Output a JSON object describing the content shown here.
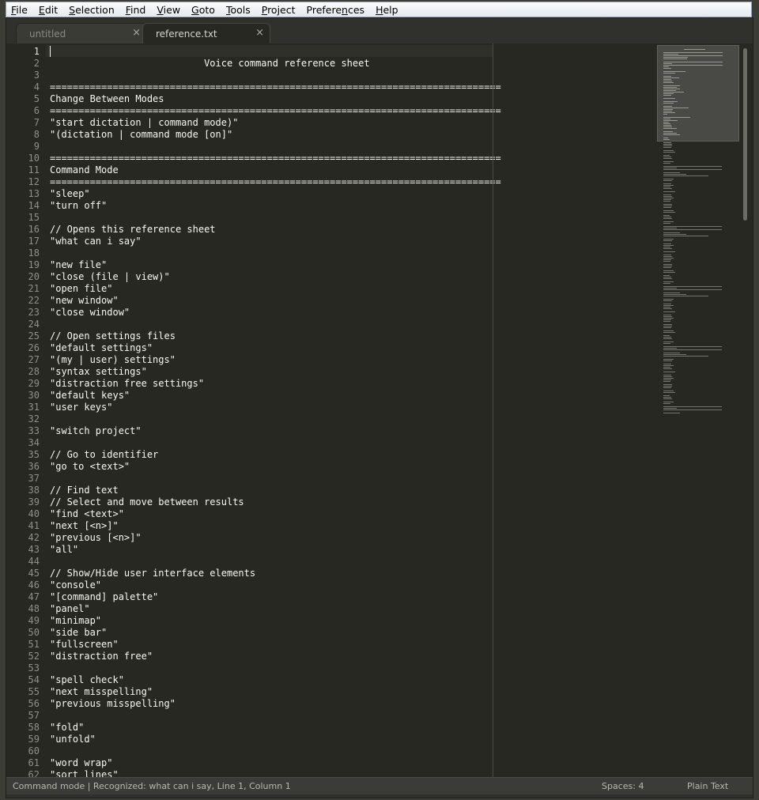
{
  "menu": [
    {
      "label": "File",
      "mnemonic": "F",
      "rest": "ile"
    },
    {
      "label": "Edit",
      "mnemonic": "E",
      "rest": "dit"
    },
    {
      "label": "Selection",
      "mnemonic": "S",
      "rest": "election"
    },
    {
      "label": "Find",
      "mnemonic": "F",
      "rest": "ind",
      "prefix": ""
    },
    {
      "label": "View",
      "mnemonic": "V",
      "rest": "iew"
    },
    {
      "label": "Goto",
      "mnemonic": "G",
      "rest": "oto"
    },
    {
      "label": "Tools",
      "mnemonic": "T",
      "rest": "ools"
    },
    {
      "label": "Project",
      "mnemonic": "P",
      "rest": "roject"
    },
    {
      "label": "Preferences",
      "mnemonic": "n",
      "prefix": "Prefere",
      "rest": "ces"
    },
    {
      "label": "Help",
      "mnemonic": "H",
      "rest": "elp"
    }
  ],
  "tabs": [
    {
      "title": "untitled",
      "close": "×",
      "active": false
    },
    {
      "title": "reference.txt",
      "close": "×",
      "active": true
    }
  ],
  "editor": {
    "current_line": 1,
    "lines": [
      "",
      "                           Voice command reference sheet",
      "",
      "===============================================================================",
      "Change Between Modes",
      "===============================================================================",
      "\"start dictation | command mode)\"",
      "\"(dictation | command mode [on]\"",
      "",
      "===============================================================================",
      "Command Mode",
      "===============================================================================",
      "\"sleep\"",
      "\"turn off\"",
      "",
      "// Opens this reference sheet",
      "\"what can i say\"",
      "",
      "\"new file\"",
      "\"close (file | view)\"",
      "\"open file\"",
      "\"new window\"",
      "\"close window\"",
      "",
      "// Open settings files",
      "\"default settings\"",
      "\"(my | user) settings\"",
      "\"syntax settings\"",
      "\"distraction free settings\"",
      "\"default keys\"",
      "\"user keys\"",
      "",
      "\"switch project\"",
      "",
      "// Go to identifier",
      "\"go to <text>\"",
      "",
      "// Find text",
      "// Select and move between results",
      "\"find <text>\"",
      "\"next [<n>]\"",
      "\"previous [<n>]\"",
      "\"all\"",
      "",
      "// Show/Hide user interface elements",
      "\"console\"",
      "\"[command] palette\"",
      "\"panel\"",
      "\"minimap\"",
      "\"side bar\"",
      "\"fullscreen\"",
      "\"distraction free\"",
      "",
      "\"spell check\"",
      "\"next misspelling\"",
      "\"previous misspelling\"",
      "",
      "\"fold\"",
      "\"unfold\"",
      "",
      "\"word wrap\"",
      "\"sort lines\""
    ]
  },
  "statusbar": {
    "text": "Command mode | Recognized: what can i say, Line 1, Column 1",
    "spaces": "Spaces: 4",
    "syntax": "Plain Text"
  },
  "colors": {
    "editor_bg": "#272822",
    "text": "#f8f8f2",
    "line_number": "#8f908a",
    "chrome": "#30312c"
  }
}
